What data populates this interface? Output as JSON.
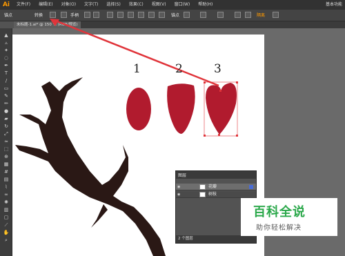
{
  "app": {
    "logo": "Ai",
    "workspace": "基本功能"
  },
  "menu": [
    "文件(F)",
    "编辑(E)",
    "对象(O)",
    "文字(T)",
    "选择(S)",
    "效果(C)",
    "视图(V)",
    "窗口(W)",
    "帮助(H)"
  ],
  "control_bar": {
    "anchor_label": "锚点",
    "convert_label": "转换",
    "handle_label": "手柄",
    "anchor_label2": "锚点",
    "isolate_label": "隔离",
    "highlight_color": "#ff9a00"
  },
  "document_tab": {
    "title": "未标题-1.ai* @ 150 % (RGB/预览)"
  },
  "tools": [
    "selection-tool",
    "direct-selection-tool",
    "magic-wand-tool",
    "lasso-tool",
    "pen-tool",
    "type-tool",
    "line-tool",
    "rectangle-tool",
    "paintbrush-tool",
    "pencil-tool",
    "blob-brush-tool",
    "eraser-tool",
    "rotate-tool",
    "scale-tool",
    "width-tool",
    "free-transform-tool",
    "shape-builder-tool",
    "perspective-grid-tool",
    "mesh-tool",
    "gradient-tool",
    "eyedropper-tool",
    "blend-tool",
    "symbol-sprayer-tool",
    "column-graph-tool",
    "artboard-tool",
    "slice-tool",
    "hand-tool",
    "zoom-tool"
  ],
  "canvas": {
    "step_labels": [
      "1",
      "2",
      "3"
    ],
    "petal_color": "#b11b2e",
    "branch_color": "#2a1815",
    "arrow_color": "#e0343a"
  },
  "layers_panel": {
    "title": "图层",
    "layers": [
      {
        "name": "花瓣",
        "selected": true,
        "swatch": "#4a6cd4"
      },
      {
        "name": "树枝",
        "selected": false,
        "swatch": "#4a6cd4"
      }
    ],
    "footer": "2 个图层"
  },
  "watermark": {
    "title": "百科全说",
    "subtitle": "助你轻松解决"
  }
}
